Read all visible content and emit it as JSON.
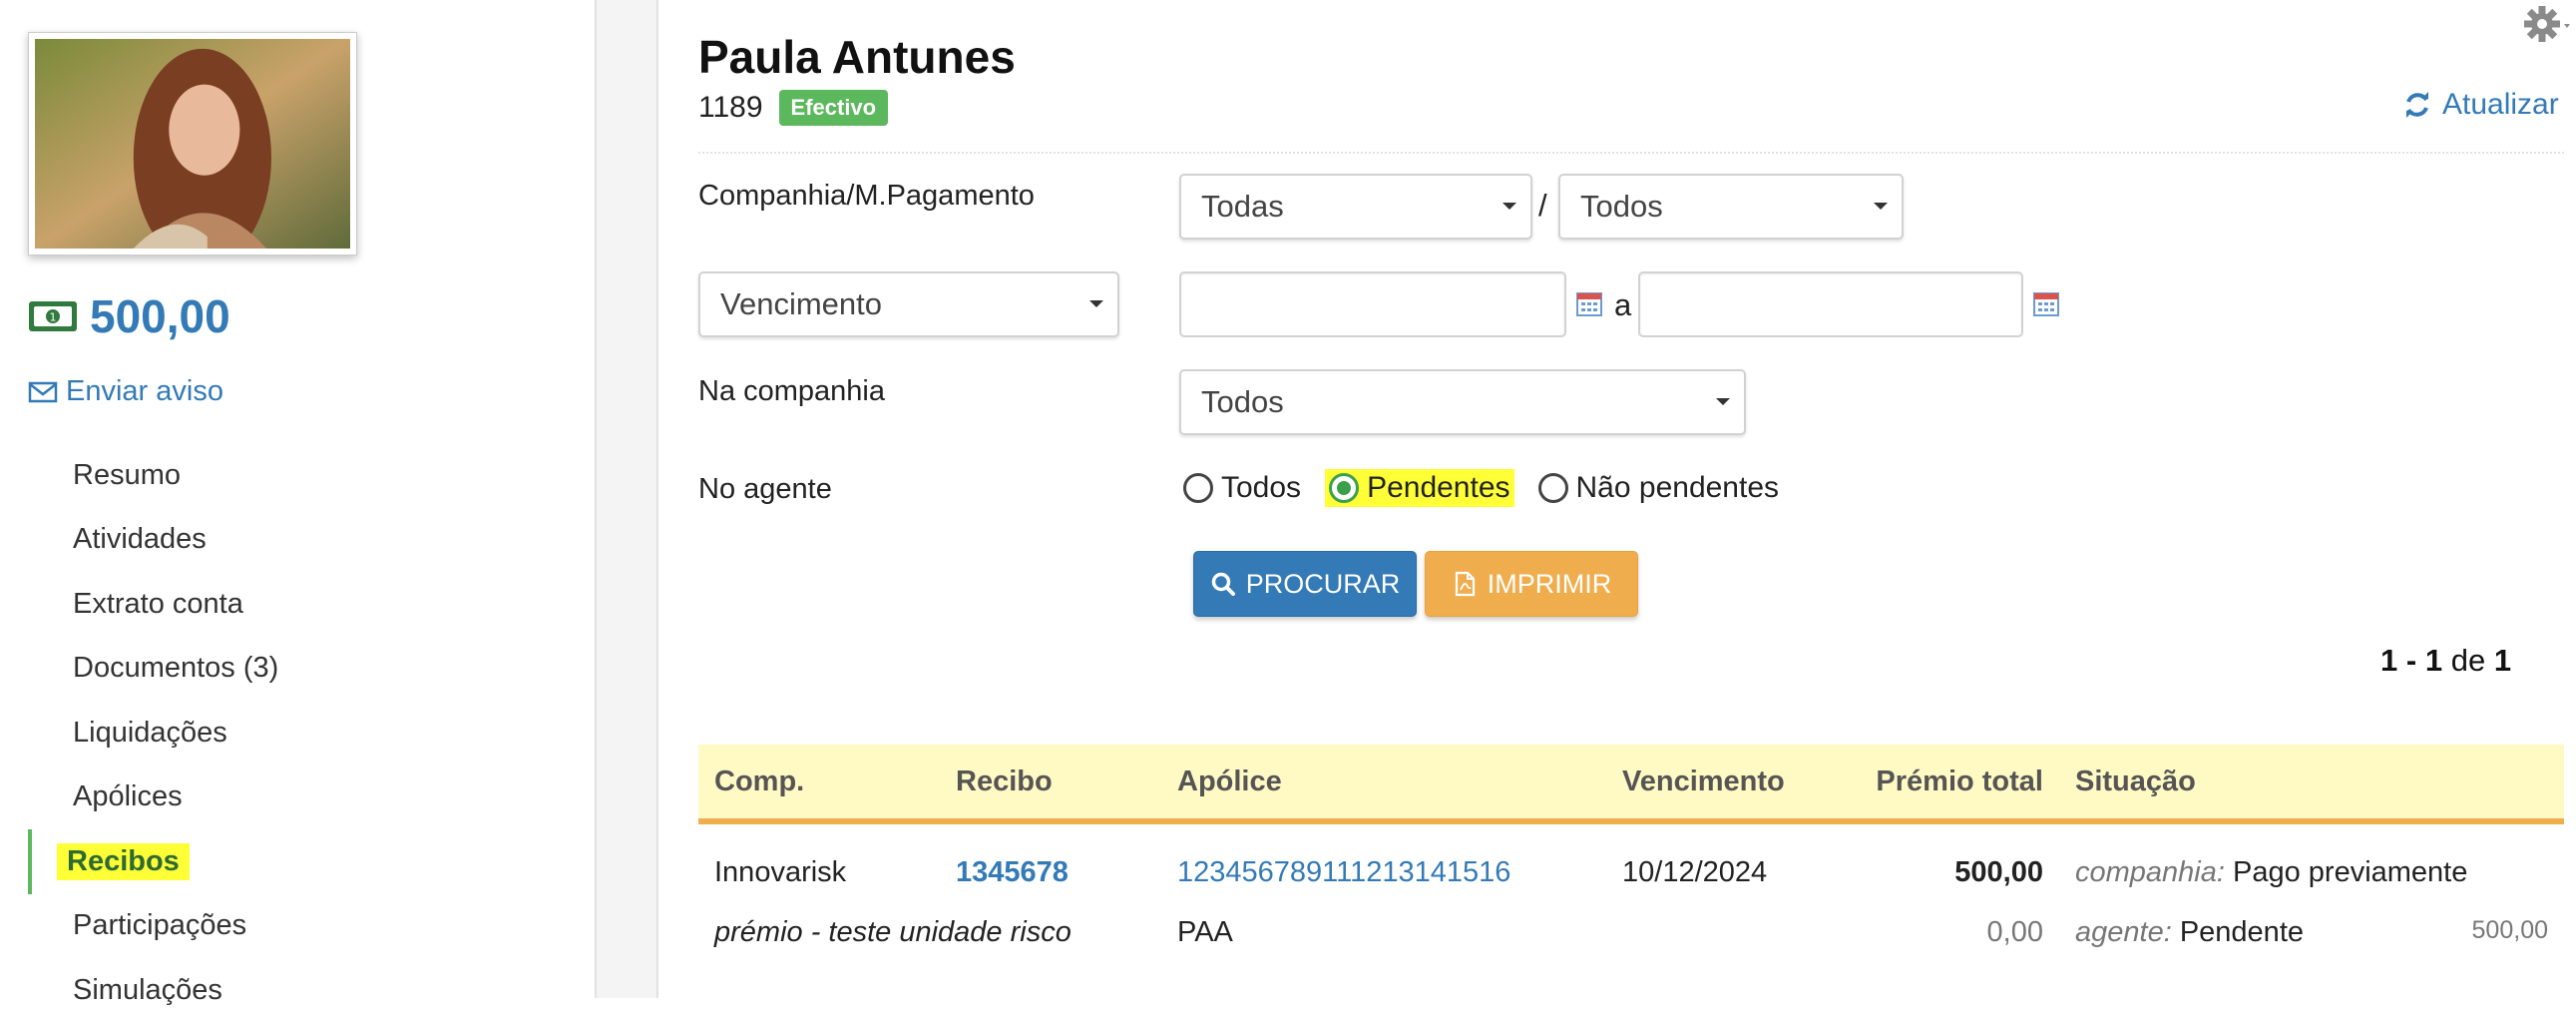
{
  "client": {
    "name": "Paula Antunes",
    "code": "1189",
    "status_badge": "Efectivo",
    "balance": "500,00",
    "send_notice_label": "Enviar aviso"
  },
  "sidebar": {
    "items": [
      {
        "label": "Resumo"
      },
      {
        "label": "Atividades"
      },
      {
        "label": "Extrato conta"
      },
      {
        "label": "Documentos (3)"
      },
      {
        "label": "Liquidações"
      },
      {
        "label": "Apólices"
      },
      {
        "label": "Recibos",
        "active": true
      },
      {
        "label": "Participações"
      },
      {
        "label": "Simulações"
      }
    ]
  },
  "header": {
    "refresh_label": "Atualizar"
  },
  "filters": {
    "company_label": "Companhia/M.Pagamento",
    "company_select": "Todas",
    "payment_select": "Todos",
    "slash": "/",
    "date_type_select": "Vencimento",
    "date_from": "",
    "date_to": "",
    "range_sep": "a",
    "in_company_label": "Na companhia",
    "in_company_select": "Todos",
    "agent_label": "No agente",
    "agent_options": [
      {
        "label": "Todos",
        "checked": false
      },
      {
        "label": "Pendentes",
        "checked": true
      },
      {
        "label": "Não pendentes",
        "checked": false
      }
    ]
  },
  "buttons": {
    "search_label": "PROCURAR",
    "print_label": "IMPRIMIR"
  },
  "pager": {
    "from": "1",
    "dash": "-",
    "to": "1",
    "of_label": "de",
    "total": "1"
  },
  "table": {
    "headers": [
      "Comp.",
      "Recibo",
      "Apólice",
      "Vencimento",
      "Prémio total",
      "Situação"
    ],
    "rows": [
      {
        "company": "Innovarisk",
        "receipt": "1345678",
        "policy": "12345678911121314151​6",
        "due_date": "10/12/2024",
        "premium_total": "500,00",
        "company_status_label": "companhia:",
        "company_status": "Pago previamente",
        "description": "prémio - teste unidade risco",
        "policy_code": "PAA",
        "premium_secondary": "0,00",
        "agent_status_label": "agente:",
        "agent_status": "Pendente",
        "agent_amount": "500,00"
      }
    ]
  },
  "colors": {
    "link": "#337ab7",
    "success": "#5cb85c",
    "warning": "#f0ad4e",
    "highlight": "#ffff38"
  }
}
